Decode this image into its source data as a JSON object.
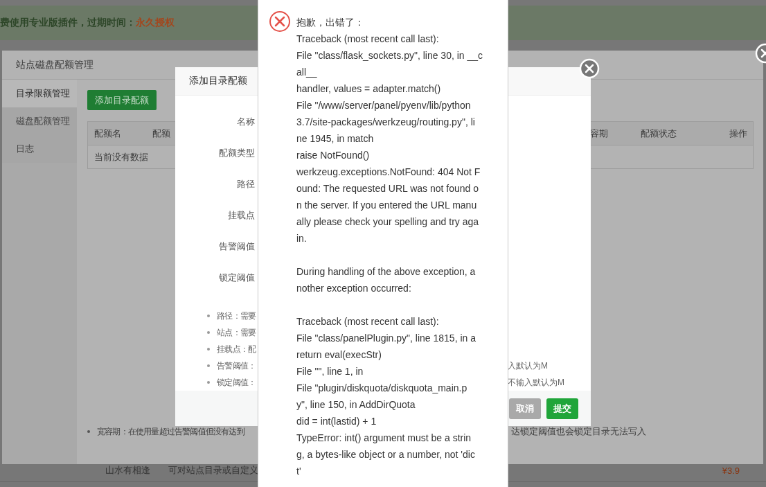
{
  "page": {
    "banner": {
      "text": "费使用专业版插件，过期时间：",
      "highlight": "永久授权"
    },
    "rows": [
      {
        "name": "山水有相逢",
        "description": "可对站点目录或自定义",
        "price": "¥3.9"
      }
    ]
  },
  "quota_window": {
    "title": "站点磁盘配额管理",
    "sidebar": {
      "items": [
        {
          "label": "目录限额管理",
          "selected": true
        },
        {
          "label": "磁盘配额管理",
          "selected": false
        },
        {
          "label": "日志",
          "selected": false
        }
      ]
    },
    "add_button": "添加目录配额",
    "table": {
      "columns": [
        "配额名",
        "配额",
        "容期",
        "配额状态",
        "操作"
      ],
      "empty_text": "当前没有数据"
    },
    "notes": [
      {
        "left": "宽容期：在使用量超过告警阈值但没有达到",
        "right": "达锁定阈值也会锁定目录无法写入"
      }
    ]
  },
  "add_dialog": {
    "title": "添加目录配额",
    "fields": [
      "名称",
      "配额类型",
      "路径",
      "挂载点",
      "告警阈值",
      "锁定阈值"
    ],
    "hints": [
      {
        "left": "路径：需要"
      },
      {
        "left": "站点：需要"
      },
      {
        "left": "挂载点：配"
      },
      {
        "left": "告警阈值：",
        "right": "入默认为M"
      },
      {
        "left": "锁定阈值：",
        "right": "不输入默认为M"
      }
    ],
    "buttons": [
      {
        "label": "取消",
        "kind": "secondary"
      },
      {
        "label": "提交",
        "kind": "primary"
      }
    ]
  },
  "error_popup": {
    "paragraphs": [
      [
        "抱歉，出错了：",
        "Traceback (most recent call last):",
        "File \"class/flask_sockets.py\", line 30, in __c",
        "all__",
        "handler, values = adapter.match()",
        "File \"/www/server/panel/pyenv/lib/python",
        "3.7/site-packages/werkzeug/routing.py\", li",
        "ne 1945, in match",
        "raise NotFound()",
        "werkzeug.exceptions.NotFound: 404 Not F",
        "ound: The requested URL was not found o",
        "n the server. If you entered the URL manu",
        "ally please check your spelling and try aga",
        "in."
      ],
      [
        "During handling of the above exception, a",
        "nother exception occurred:"
      ],
      [
        "Traceback (most recent call last):",
        "File \"class/panelPlugin.py\", line 1815, in a",
        "return eval(execStr)",
        "File \"\", line 1, in",
        "File \"plugin/diskquota/diskquota_main.p",
        "y\", line 150, in AddDirQuota",
        "did = int(lastid) + 1",
        "TypeError: int() argument must be a strin",
        "g, a bytes-like object or a number, not 'dic",
        "t'"
      ]
    ]
  }
}
